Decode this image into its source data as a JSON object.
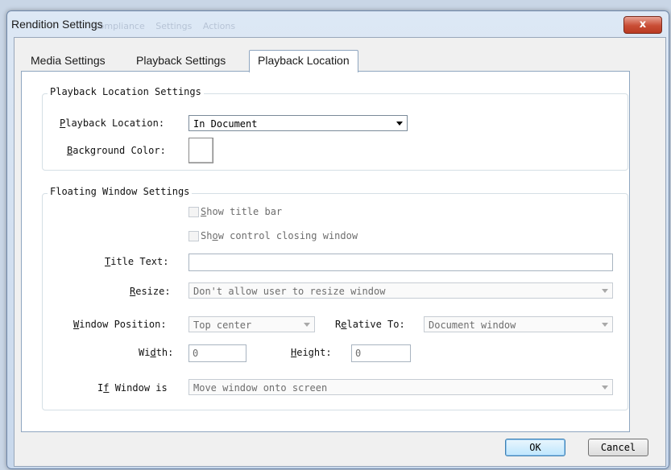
{
  "window": {
    "title": "Rendition Settings",
    "close_glyph": "x",
    "background_tabs": [
      "Compliance",
      "Settings",
      "Actions"
    ]
  },
  "tabs": [
    {
      "label": "Media Settings",
      "active": false
    },
    {
      "label": "Playback Settings",
      "active": false
    },
    {
      "label": "Playback Location",
      "active": true
    }
  ],
  "playback_location_group": {
    "legend": "Playback Location Settings",
    "location_label": "Playback Location:",
    "location_value": "In Document",
    "background_color_label": "Background Color:",
    "background_color": "#ffffff"
  },
  "floating_window_group": {
    "legend": "Floating Window Settings",
    "show_title_bar": {
      "label": "Show title bar",
      "checked": false,
      "enabled": false
    },
    "show_control_closing": {
      "label": "Show control closing window",
      "checked": false,
      "enabled": false
    },
    "title_text_label": "Title Text:",
    "title_text_value": "",
    "resize_label": "Resize:",
    "resize_value": "Don't allow user to resize window",
    "window_position_label": "Window Position:",
    "window_position_value": "Top center",
    "relative_to_label": "Relative To:",
    "relative_to_value": "Document window",
    "width_label": "Width:",
    "width_value": "0",
    "height_label": "Height:",
    "height_value": "0",
    "if_window_label": "If Window is",
    "if_window_value": "Move window onto screen"
  },
  "buttons": {
    "ok": "OK",
    "cancel": "Cancel"
  },
  "colors": {
    "accent": "#3c7fb1",
    "close": "#c94d35",
    "disabled_text": "#6d6d6d"
  }
}
